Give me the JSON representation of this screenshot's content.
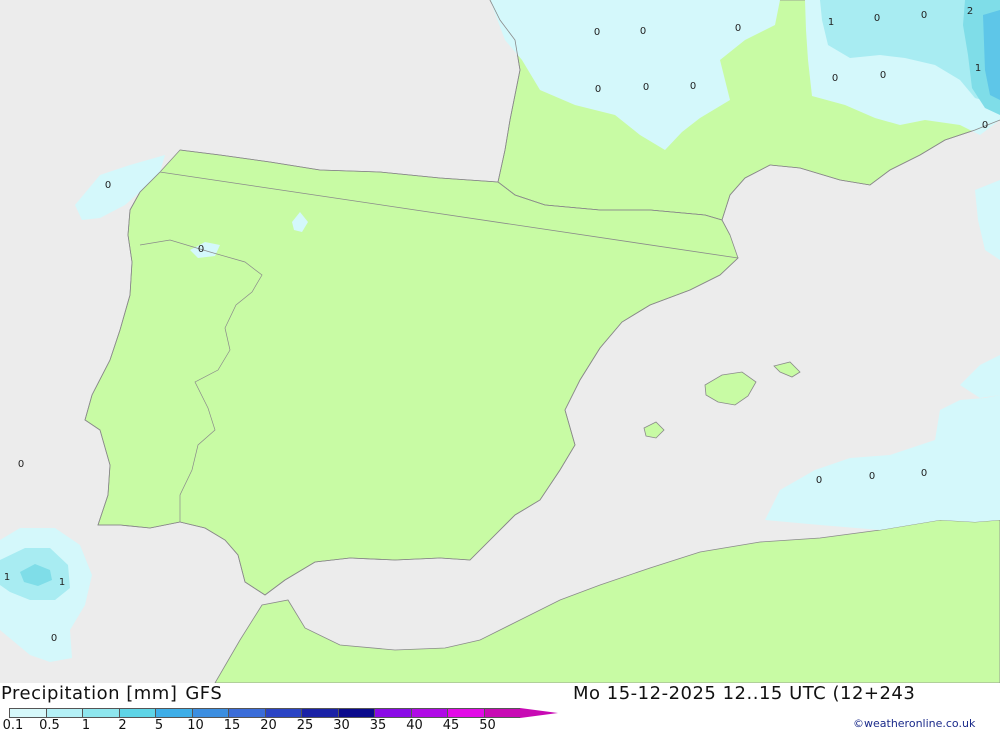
{
  "map": {
    "colors": {
      "sea": "#ececec",
      "land": "#c8fba4",
      "light_precip": "#d4f8fb",
      "precip_0_5": "#a8ecf2",
      "precip_1": "#7fdde8",
      "coastline": "#8a8a8a"
    },
    "value_labels": [
      "0",
      "0",
      "0",
      "1",
      "0",
      "0",
      "2",
      "0",
      "0",
      "0",
      "0",
      "0",
      "1",
      "0",
      "0",
      "0",
      "0",
      "0",
      "0",
      "0",
      "1",
      "1",
      "0"
    ]
  },
  "footer": {
    "title": "Precipitation [mm]",
    "model": "GFS",
    "run_time": "Mo 15-12-2025 12..15 UTC (12+243",
    "credit": "©weatheronline.co.uk"
  },
  "legend": {
    "ticks": [
      "0.1",
      "0.5",
      "1",
      "2",
      "5",
      "10",
      "15",
      "20",
      "25",
      "30",
      "35",
      "40",
      "45",
      "50"
    ],
    "colors": [
      "#d6f8fa",
      "#b4f0f6",
      "#8ee6ee",
      "#5ed4e6",
      "#3eaee8",
      "#3c8ee0",
      "#3a6cd8",
      "#2a44c4",
      "#1a22a6",
      "#0a0a8c",
      "#8a0ae6",
      "#b00ae6",
      "#e20ae6",
      "#c80ab4"
    ]
  }
}
